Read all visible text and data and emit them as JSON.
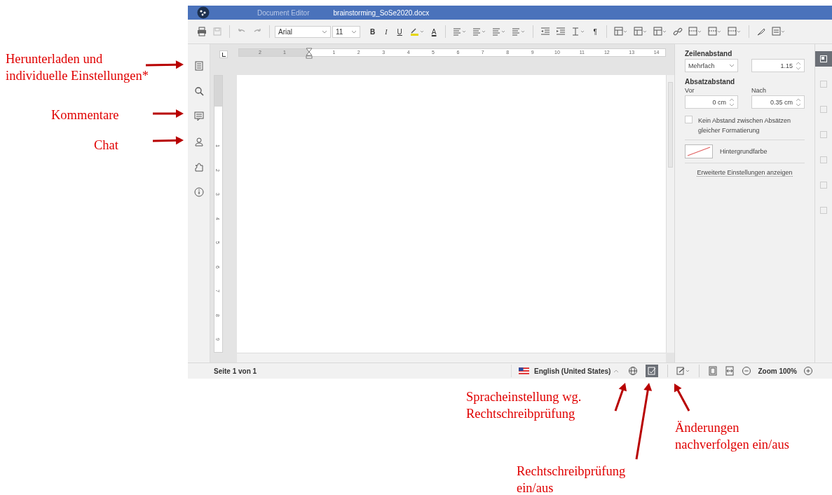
{
  "window": {
    "app_title": "Document Editor",
    "file_name": "brainstorming_SoSe2020.docx"
  },
  "toolbar": {
    "font": "Arial",
    "font_size": "11",
    "bold": "B",
    "italic": "I",
    "underline": "U",
    "font_color": "A",
    "paragraph_mark": "¶"
  },
  "ruler": {
    "left_labels": [
      "2",
      "1"
    ],
    "right_labels": [
      "1",
      "2",
      "3",
      "4",
      "5",
      "6",
      "7",
      "8",
      "9",
      "10",
      "11",
      "12",
      "13",
      "14"
    ],
    "vertical_labels": [
      "1",
      "2",
      "3",
      "4",
      "5",
      "6",
      "7",
      "8",
      "9"
    ]
  },
  "left_sidebar": [
    {
      "selected": false
    },
    {
      "selected": false
    },
    {
      "selected": false
    },
    {
      "selected": false
    },
    {
      "selected": false
    },
    {
      "selected": false
    }
  ],
  "paragraph_panel": {
    "line_spacing_heading": "Zeilenabstand",
    "line_spacing_mode": "Mehrfach",
    "line_spacing_value": "1.15",
    "paragraph_spacing_heading": "Absatzabstand",
    "before_label": "Vor",
    "after_label": "Nach",
    "before_value": "0 cm",
    "after_value": "0.35 cm",
    "no_spacing_checked": false,
    "no_spacing_label": "Kein Abstand zwischen Absätzen gleicher Formatierung",
    "background_color_label": "Hintergrundfarbe",
    "advanced_link": "Erweiterte Einstellungen anzeigen"
  },
  "right_tabs": [
    {
      "selected": true
    },
    {
      "selected": false
    },
    {
      "selected": false
    },
    {
      "selected": false
    },
    {
      "selected": false
    },
    {
      "selected": false
    },
    {
      "selected": false
    }
  ],
  "status_bar": {
    "page_info": "Seite 1 von 1",
    "language": "English (United States)",
    "spellcheck_on": true,
    "zoom": "Zoom 100%"
  },
  "annotations": [
    {
      "lines": [
        "Herunterladen und",
        "individuelle Einstellungen*"
      ]
    },
    {
      "lines": [
        "Kommentare"
      ]
    },
    {
      "lines": [
        "Chat"
      ]
    },
    {
      "lines": [
        "Spracheinstellung wg.",
        "Rechtschreibprüfung"
      ]
    },
    {
      "lines": [
        "Rechtschreibprüfung",
        "ein/aus"
      ]
    },
    {
      "lines": [
        "Änderungen",
        "nachverfolgen ein/aus"
      ]
    }
  ]
}
